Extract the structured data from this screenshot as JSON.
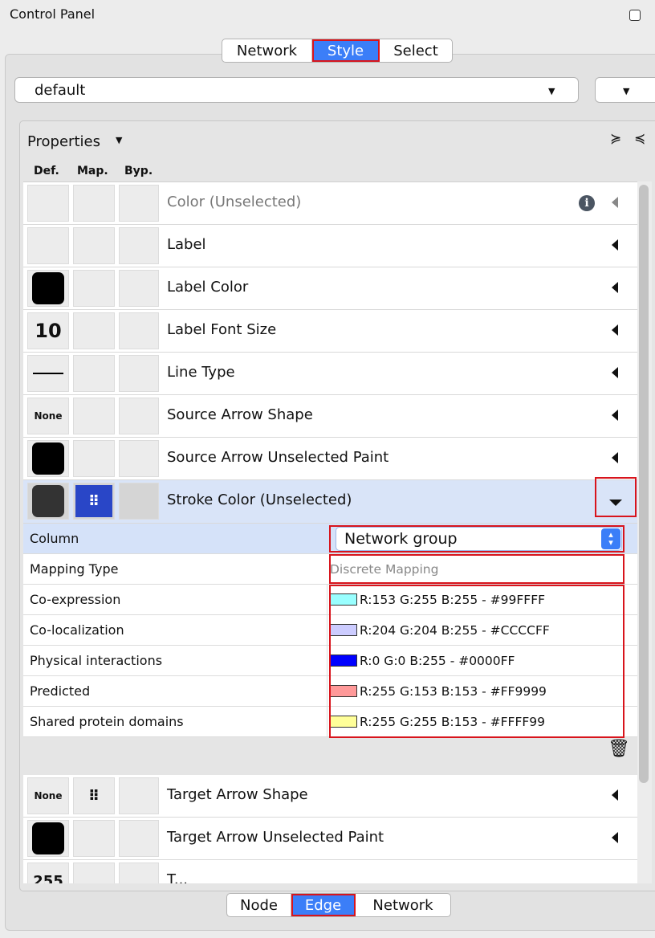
{
  "window": {
    "title": "Control Panel",
    "menu_icon": "⋮"
  },
  "top_tabs": [
    {
      "label": "Network",
      "active": false
    },
    {
      "label": "Style",
      "active": true
    },
    {
      "label": "Select",
      "active": false
    }
  ],
  "style_selector": {
    "value": "default"
  },
  "properties": {
    "label": "Properties",
    "columns": {
      "def": "Def.",
      "map": "Map.",
      "byp": "Byp."
    },
    "rows": [
      {
        "label": "Color (Unselected)",
        "def": "",
        "disabled": true
      },
      {
        "label": "Label",
        "def": ""
      },
      {
        "label": "Label Color",
        "def": "black-swatch"
      },
      {
        "label": "Label Font Size",
        "def": "10"
      },
      {
        "label": "Line Type",
        "def": "line-swatch"
      },
      {
        "label": "Source Arrow Shape",
        "def": "None"
      },
      {
        "label": "Source Arrow Unselected Paint",
        "def": "black-swatch"
      },
      {
        "label": "Stroke Color (Unselected)",
        "def": "dark-swatch",
        "map": "discrete-mapping-icon",
        "expanded": true
      },
      {
        "label": "Target Arrow Shape",
        "def": "None",
        "map": "discrete-mapping-icon"
      },
      {
        "label": "Target Arrow Unselected Paint",
        "def": "black-swatch"
      },
      {
        "label": "T...",
        "def": "255"
      }
    ]
  },
  "mapping": {
    "column_label": "Column",
    "column_value": "Network group",
    "type_label": "Mapping Type",
    "type_value": "Discrete Mapping",
    "entries": [
      {
        "key": "Co-expression",
        "value": "R:153 G:255 B:255 - #99FFFF",
        "color": "#99FFFF"
      },
      {
        "key": "Co-localization",
        "value": "R:204 G:204 B:255 - #CCCCFF",
        "color": "#CCCCFF"
      },
      {
        "key": "Physical interactions",
        "value": "R:0 G:0 B:255 - #0000FF",
        "color": "#0000FF"
      },
      {
        "key": "Predicted",
        "value": "R:255 G:153 B:153 - #FF9999",
        "color": "#FF9999"
      },
      {
        "key": "Shared protein domains",
        "value": "R:255 G:255 B:153 - #FFFF99",
        "color": "#FFFF99"
      }
    ]
  },
  "bottom_tabs": [
    {
      "label": "Node",
      "active": false
    },
    {
      "label": "Edge",
      "active": true
    },
    {
      "label": "Network",
      "active": false
    }
  ],
  "colors": {
    "accent": "#3B7EF8",
    "highlight_box": "#D8141C",
    "mapping_icon": "#2946C7"
  }
}
